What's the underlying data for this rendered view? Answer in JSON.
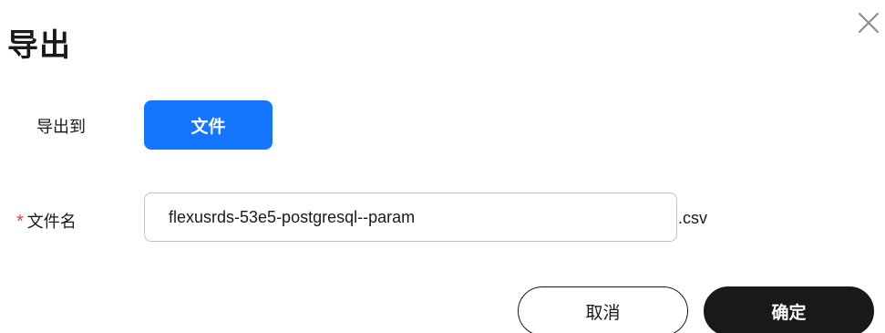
{
  "dialog": {
    "title": "导出",
    "close_icon": "close-icon"
  },
  "export_to": {
    "label": "导出到",
    "option_label": "文件",
    "option_color": "#1476ff"
  },
  "filename": {
    "required_mark": "*",
    "label": "文件名",
    "value": "flexusrds-53e5-postgresql--param",
    "suffix": ".csv",
    "required_color": "#e8403b"
  },
  "footer": {
    "cancel_label": "取消",
    "confirm_label": "确定"
  }
}
